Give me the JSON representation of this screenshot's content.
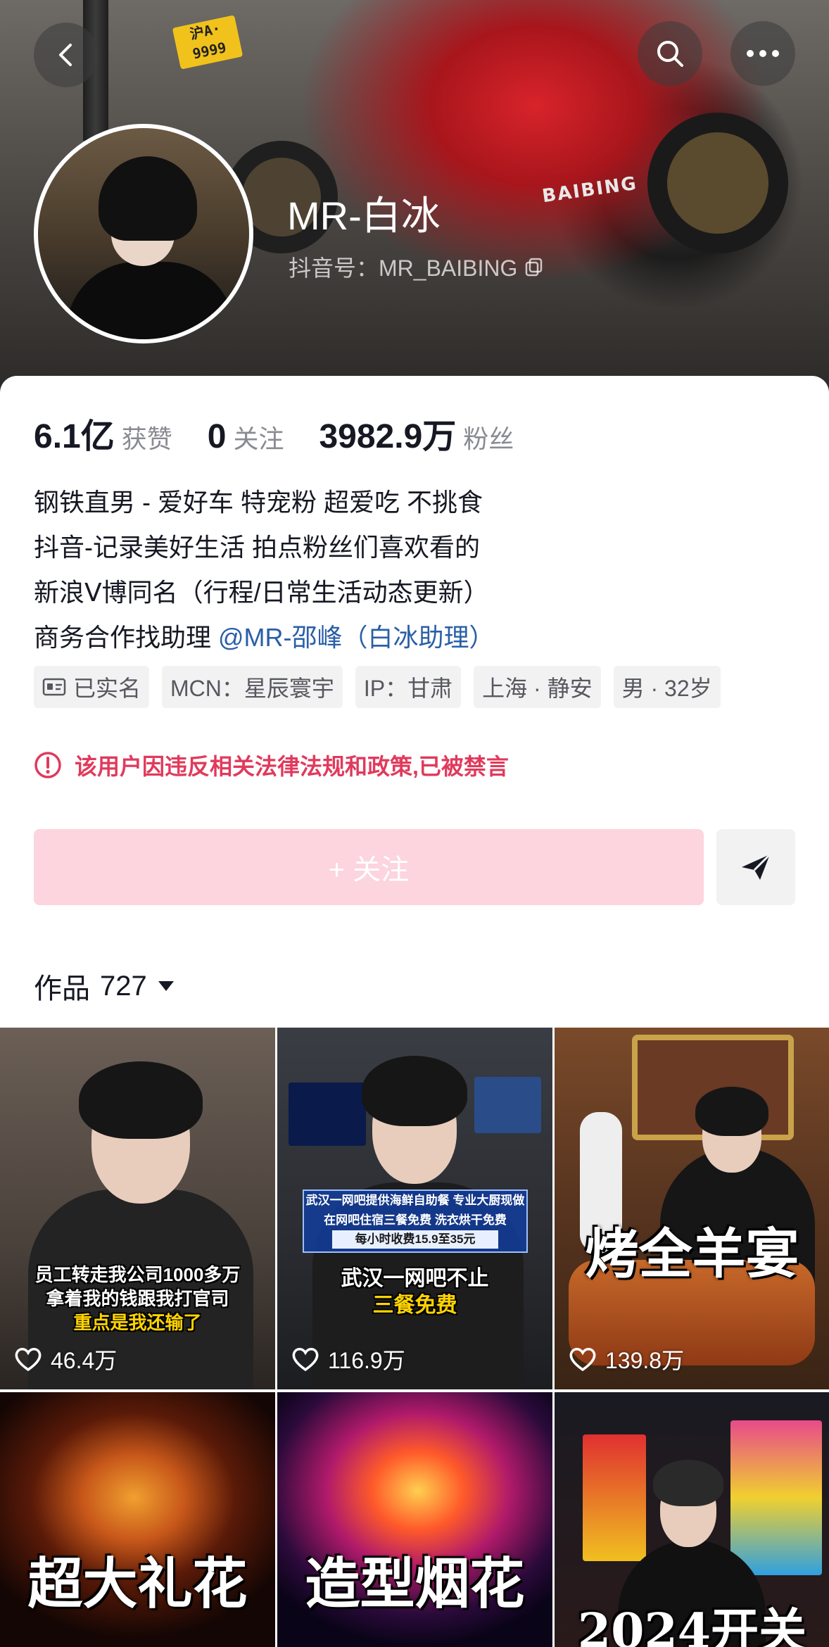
{
  "header": {
    "back_icon": "chevron-left-icon",
    "search_icon": "search-icon",
    "more_icon": "more-dots-icon",
    "nickname": "MR-白冰",
    "account_id": "抖音号：MR_BAIBING",
    "cover_plate": "沪A·\n9999",
    "cover_brand": "BAIBING"
  },
  "stats": [
    {
      "value": "6.1亿",
      "label": "获赞"
    },
    {
      "value": "0",
      "label": "关注"
    },
    {
      "value": "3982.9万",
      "label": "粉丝"
    }
  ],
  "bio": {
    "line1": "钢铁直男 - 爱好车 特宠粉 超爱吃 不挑食",
    "line2": "抖音-记录美好生活 拍点粉丝们喜欢看的",
    "line3": "新浪Ⅴ博同名（行程/日常生活动态更新）",
    "line4_prefix": "商务合作找助理 ",
    "line4_mention": "@MR-邵峰（白冰助理）"
  },
  "tags": [
    "已实名",
    "MCN：星辰寰宇",
    "IP：甘肃",
    "上海 · 静安",
    "男 · 32岁"
  ],
  "ban_notice": "该用户因违反相关法律法规和政策,已被禁言",
  "follow_button": "+ 关注",
  "works": {
    "title": "作品",
    "count": "727"
  },
  "videos": [
    {
      "caption1": "员工转走我公司1000多万",
      "caption2": "拿着我的钱跟我打官司",
      "caption3": "重点是我还输了",
      "likes": "46.4万"
    },
    {
      "banner1": "武汉一网吧提供海鲜自助餐 专业大厨现做",
      "banner2": "在网吧住宿三餐免费 洗衣烘干免费",
      "banner3": "每小时收费15.9至35元",
      "caption1": "武汉一网吧不止",
      "caption2": "三餐免费",
      "likes": "116.9万"
    },
    {
      "title": "烤全羊宴",
      "likes": "139.8万"
    },
    {
      "title": "超大礼花"
    },
    {
      "title": "造型烟花"
    },
    {
      "title": "2024开关"
    }
  ],
  "colors": {
    "accent_pink": "#fcd5de",
    "ban_red": "#e03a5c",
    "mention_blue": "#2a5fa7"
  }
}
